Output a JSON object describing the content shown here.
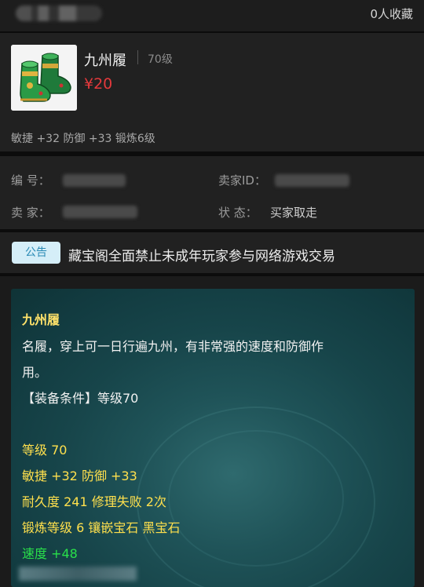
{
  "header": {
    "favorites": "0人收藏"
  },
  "product": {
    "name": "九州履",
    "level": "70级",
    "price": "¥20",
    "stats_line": "敏捷 +32 防御 +33 锻炼6级"
  },
  "info": {
    "id_label": "编  号：",
    "seller_label": "卖  家：",
    "seller_id_label": "卖家ID：",
    "status_label": "状  态：",
    "status_value": "买家取走"
  },
  "notice": {
    "badge": "公告",
    "text": "藏宝阁全面禁止未成年玩家参与网络游戏交易"
  },
  "tooltip": {
    "title": "九州履",
    "desc_1": "名履，穿上可一日行遍九州，有非常强的速度和防御作",
    "desc_2": "用。",
    "requirement": "【装备条件】等级70",
    "level": "等级 70",
    "stats": "敏捷 +32 防御 +33",
    "durability": "耐久度 241 修理失败 2次",
    "forge": "锻炼等级 6 镶嵌宝石 黑宝石",
    "bonus": "速度 +48"
  },
  "colors": {
    "price": "#e4393c",
    "tooltip_title": "#ffe26a",
    "tooltip_yellow": "#ffe04d",
    "tooltip_green": "#29e04a",
    "notice_badge_bg": "#d5eef8"
  }
}
